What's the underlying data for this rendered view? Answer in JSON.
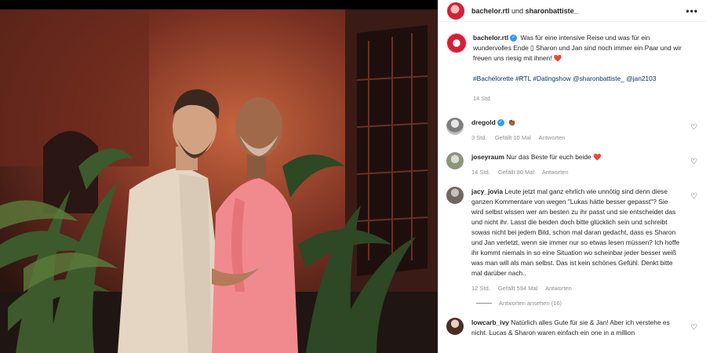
{
  "header": {
    "account1": "bachelor.rtl",
    "separator": "und",
    "account2": "sharonbattiste_",
    "more_icon": "more-horizontal-icon"
  },
  "post": {
    "username": "bachelor.rtl",
    "caption": "Was für eine intensive Reise und was für ein wundervolles Ende ▯ Sharon und Jan sind noch immer ein Paar und wir freuen uns riesig mit ihnen! ",
    "caption_heart": "❤️",
    "tags": "#Bachelorette #RTL #Datingshow @sharonbattiste_ @jan2103",
    "time": "14 Std."
  },
  "comments": [
    {
      "username": "dregold",
      "verified": true,
      "text": "👏🏾",
      "time": "3 Std.",
      "likes": "Gefällt 10 Mal",
      "reply": "Antworten"
    },
    {
      "username": "joseyraum",
      "verified": false,
      "text": "Nur das Beste für euch beide ",
      "heart": "❤️",
      "time": "14 Std.",
      "likes": "Gefällt 80 Mal",
      "reply": "Antworten"
    },
    {
      "username": "jacy_jovia",
      "verified": false,
      "text": "Leute jetzt mal ganz ehrlich wie unnötig sind denn diese ganzen Kommentare von wegen \"Lukas hätte besser gepasst\"? Sie wird selbst wissen wer am besten zu ihr passt und sie entscheidet das und nicht ihr. Lasst die beiden doch bitte glücklich sein und schreibt sowas nicht bei jedem Bild, schon mal daran gedacht, dass es Sharon und Jan verletzt, wenn sie immer nur so etwas lesen müssen? Ich hoffe ihr kommt niemals in so eine Situation wo scheinbar jeder besser weiß was man will als man selbst. Das ist kein schönes Gefühl. Denkt bitte mal darüber nach..",
      "time": "12 Std.",
      "likes": "Gefällt 594 Mal",
      "reply": "Antworten",
      "view_replies": "Antworten ansehen (16)"
    },
    {
      "username": "lowcarb_ivy",
      "verified": false,
      "text": "Natürlich alles Gute für sie & Jan! Aber ich verstehe es nicht. Lucas & Sharon waren einfach ein one in a million",
      "time": "",
      "likes": "",
      "reply": ""
    }
  ],
  "colors": {
    "link": "#00376b",
    "muted": "#8e8e8e",
    "verified": "#3897f0",
    "heart": "#ed4956",
    "brand": "#d3203a"
  }
}
